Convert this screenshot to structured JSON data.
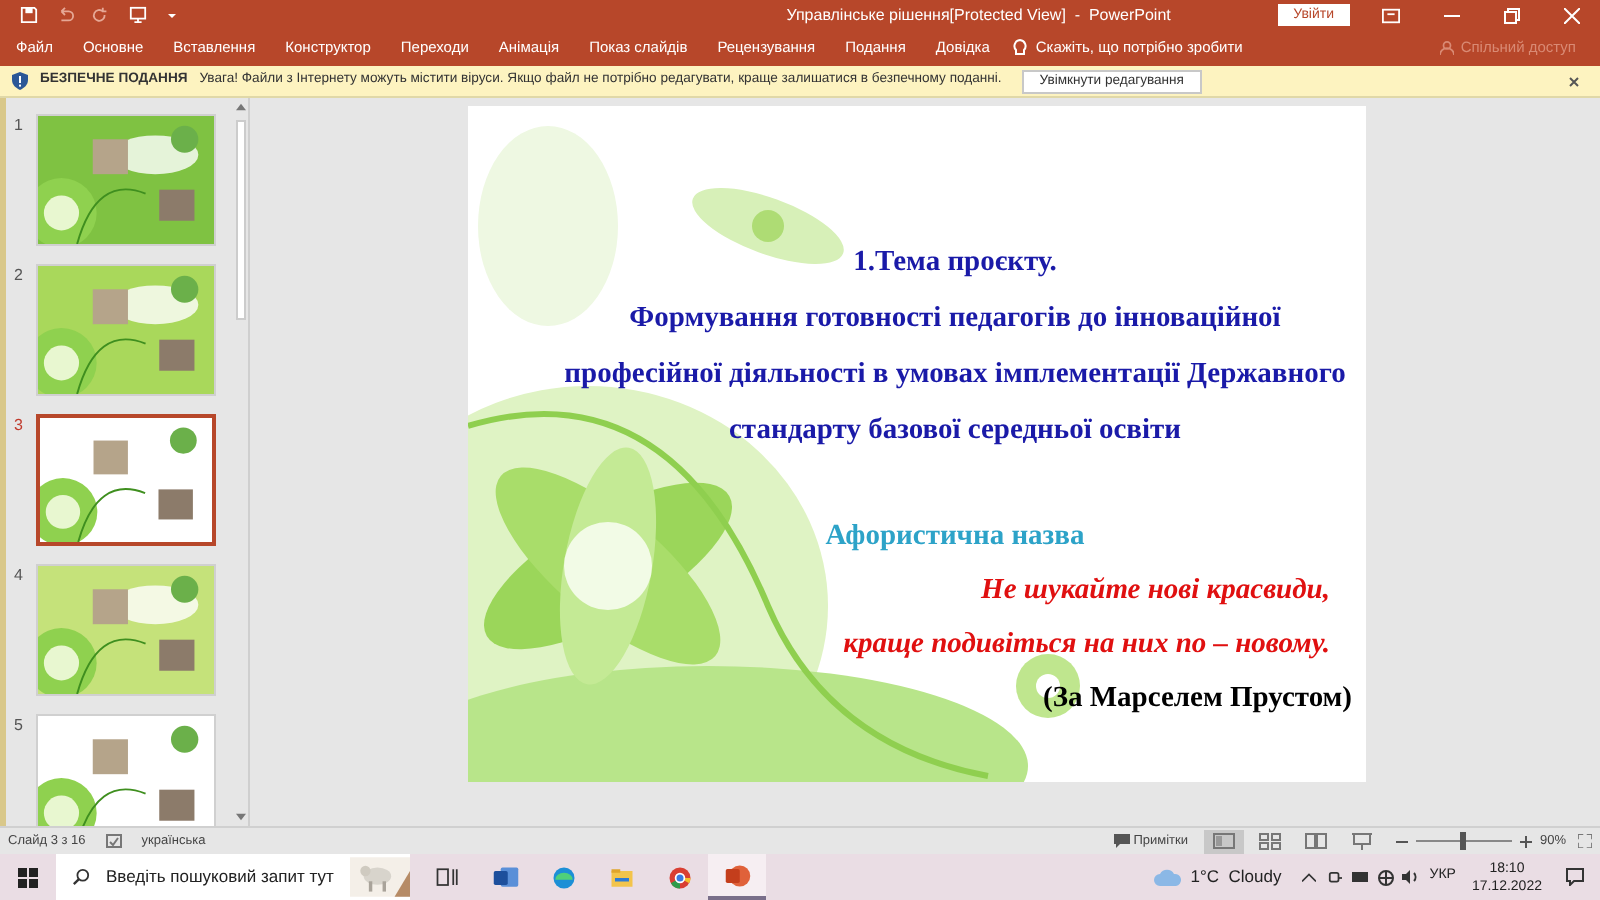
{
  "title_bar": {
    "title": "Управлінське рішення[Protected View]  -  PowerPoint",
    "sign_in": "Увійти"
  },
  "ribbon": {
    "tabs": [
      "Файл",
      "Основне",
      "Вставлення",
      "Конструктор",
      "Переходи",
      "Анімація",
      "Показ слайдів",
      "Рецензування",
      "Подання",
      "Довідка"
    ],
    "tell_me": "Скажіть, що потрібно зробити",
    "share": "Спільний доступ"
  },
  "protected_view": {
    "label": "БЕЗПЕЧНЕ ПОДАННЯ",
    "message": "Увага! Файли з Інтернету можуть містити віруси. Якщо файл не потрібно редагувати, краще залишатися в безпечному поданні.",
    "button": "Увімкнути редагування"
  },
  "thumbnails": [
    {
      "number": "1",
      "selected": false
    },
    {
      "number": "2",
      "selected": false
    },
    {
      "number": "3",
      "selected": true
    },
    {
      "number": "4",
      "selected": false
    },
    {
      "number": "5",
      "selected": false
    }
  ],
  "slide": {
    "lines": [
      {
        "kind": "heading",
        "text": "1.Тема проєкту."
      },
      {
        "kind": "body",
        "text": "Формування готовності педагогів до інноваційної професійної діяльності в умовах імплементації Державного стандарту базової середньої освіти"
      },
      {
        "kind": "subheading",
        "text": "Афористична назва"
      },
      {
        "kind": "quote",
        "text": "Не шукайте нові красвиди,"
      },
      {
        "kind": "quote",
        "text": "краще подивіться на них по – новому."
      },
      {
        "kind": "attribution",
        "text": "(За Марселем Прустом)"
      }
    ]
  },
  "status_bar": {
    "slide": "Слайд 3 з 16",
    "language": "українська",
    "notes": "Примітки",
    "views": [
      {
        "kind": "normal",
        "selected": true
      },
      {
        "kind": "sorter",
        "selected": false
      },
      {
        "kind": "reading",
        "selected": false
      },
      {
        "kind": "slideshow",
        "selected": false
      }
    ],
    "zoom": {
      "level": 0.5,
      "reading": "90%"
    }
  },
  "taskbar": {
    "search_placeholder": "Введіть пошуковий запит тут",
    "apps": [
      {
        "kind": "taskview",
        "selected": false
      },
      {
        "kind": "word",
        "selected": false
      },
      {
        "kind": "edge",
        "selected": false
      },
      {
        "kind": "explorer",
        "selected": false
      },
      {
        "kind": "chrome",
        "selected": false
      },
      {
        "kind": "powerpoint",
        "selected": true
      }
    ],
    "weather": "1°C  Cloudy",
    "language": "УКР",
    "time": "18:10",
    "date": "17.12.2022"
  }
}
